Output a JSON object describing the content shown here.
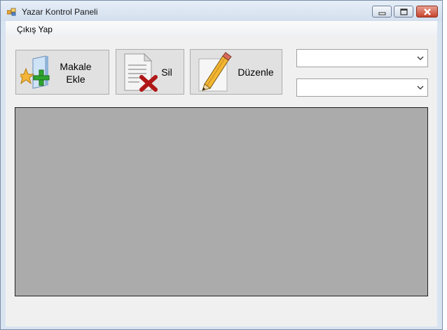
{
  "window": {
    "title": "Yazar Kontrol Paneli"
  },
  "menu": {
    "items": [
      {
        "label": "Çıkış Yap"
      }
    ]
  },
  "toolbar": {
    "add_label_line1": "Makale",
    "add_label_line2": "Ekle",
    "delete_label": "Sil",
    "edit_label": "Düzenle"
  },
  "combos": [
    {
      "value": ""
    },
    {
      "value": ""
    }
  ],
  "colors": {
    "panel": "#ababab",
    "client": "#f0f0f0",
    "button_face": "#e1e1e1"
  },
  "icons": {
    "app": "app-windows-icon",
    "add": "add-article-icon",
    "delete": "delete-document-icon",
    "edit": "edit-pencil-icon"
  }
}
